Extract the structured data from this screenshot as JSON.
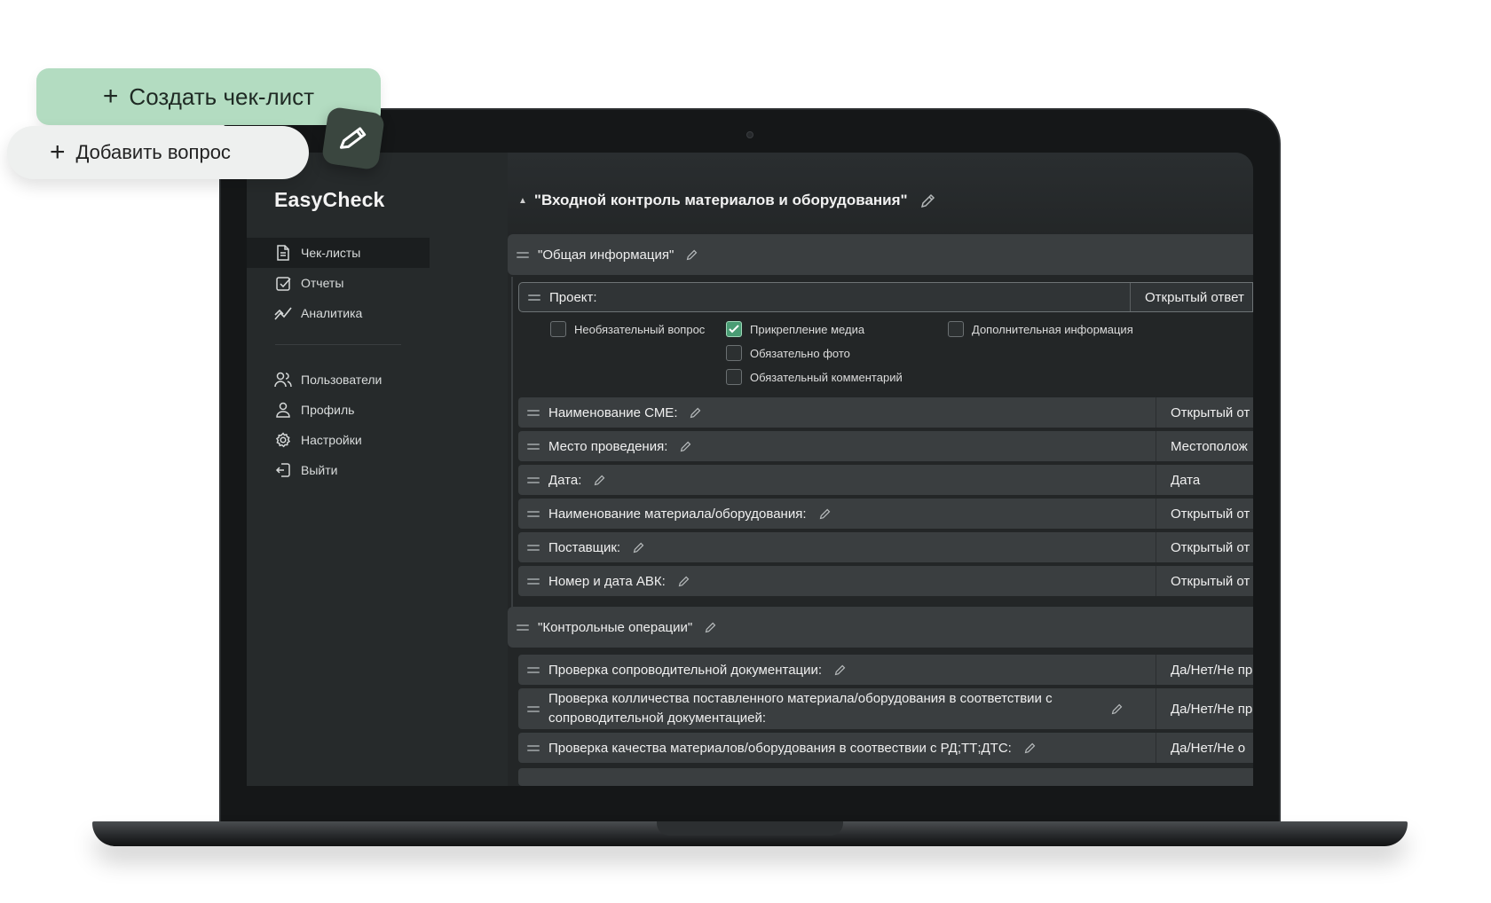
{
  "floating": {
    "create_label": "Создать чек-лист",
    "add_question_label": "Добавить вопрос"
  },
  "app": {
    "brand": "EasyCheck"
  },
  "sidebar": {
    "items": [
      {
        "label": "Чек-листы",
        "icon": "document-icon",
        "active": true
      },
      {
        "label": "Отчеты",
        "icon": "check-square-icon"
      },
      {
        "label": "Аналитика",
        "icon": "trend-icon"
      }
    ],
    "items2": [
      {
        "label": "Пользователи",
        "icon": "users-icon"
      },
      {
        "label": "Профиль",
        "icon": "user-icon"
      },
      {
        "label": "Настройки",
        "icon": "gear-icon"
      },
      {
        "label": "Выйти",
        "icon": "logout-icon"
      }
    ]
  },
  "checklist": {
    "title": "\"Входной контроль материалов и оборудования\"",
    "sections": [
      {
        "title": "\"Общая информация\""
      },
      {
        "title": "\"Контрольные операции\""
      }
    ],
    "project_row": {
      "label": "Проект:",
      "type": "Открытый ответ"
    },
    "options": {
      "optional": "Необязательный вопрос",
      "media": "Прикрепление медиа",
      "media_checked": true,
      "extra": "Дополнительная информация",
      "photo": "Обязательно фото",
      "comment": "Обязательный комментарий"
    },
    "rows": [
      {
        "label": "Наименование СМЕ:",
        "type": "Открытый от"
      },
      {
        "label": "Место проведения:",
        "type": "Местополож"
      },
      {
        "label": "Дата:",
        "type": "Дата"
      },
      {
        "label": "Наименование материала/оборудования:",
        "type": "Открытый от"
      },
      {
        "label": "Поставщик:",
        "type": "Открытый от"
      },
      {
        "label": "Номер и дата АВК:",
        "type": "Открытый от"
      }
    ],
    "rows2": [
      {
        "label": "Проверка сопроводительной документации:",
        "type": "Да/Нет/Не пр"
      },
      {
        "label": "Проверка колличества поставленного материала/оборудования в соответствии с сопроводительной документацией:",
        "type": "Да/Нет/Не пр"
      },
      {
        "label": "Проверка качества материалов/оборудования в соотвествии с РД;ТТ;ДТС:",
        "type": "Да/Нет/Не о"
      }
    ]
  },
  "colors": {
    "accent_green": "#b3dcc1",
    "checkbox_on": "#4a9c74",
    "screen_bg": "#232627"
  }
}
